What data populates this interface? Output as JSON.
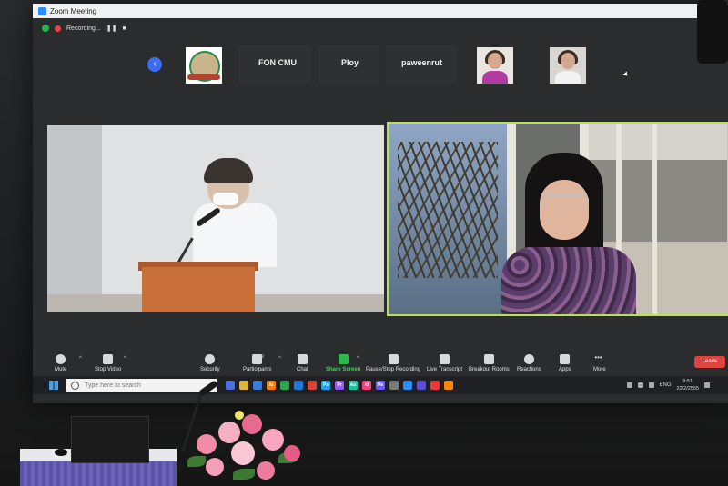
{
  "window": {
    "title": "Zoom Meeting",
    "controls": "– ◻ ✕"
  },
  "recording": {
    "label": "Recording..."
  },
  "participants_strip": {
    "names": [
      "FON CMU",
      "Ploy",
      "paweenrut"
    ]
  },
  "toolbar": {
    "mute": "Mute",
    "stop_video": "Stop Video",
    "security": "Security",
    "participants": "Participants",
    "participant_count": "9",
    "chat": "Chat",
    "share_screen": "Share Screen",
    "pause_stop_recording": "Pause/Stop Recording",
    "live_transcript": "Live Transcript",
    "breakout_rooms": "Breakout Rooms",
    "reactions": "Reactions",
    "apps": "Apps",
    "more": "More",
    "leave": "Leave"
  },
  "taskbar": {
    "search_placeholder": "Type here to search",
    "apps": [
      {
        "label": "",
        "color": "#4a6fe0"
      },
      {
        "label": "",
        "color": "#e0b33a"
      },
      {
        "label": "",
        "color": "#3a7bd5"
      },
      {
        "label": "Ai",
        "color": "#ff7c00"
      },
      {
        "label": "",
        "color": "#2aa84a"
      },
      {
        "label": "",
        "color": "#1f7ae0"
      },
      {
        "label": "",
        "color": "#d6453a"
      },
      {
        "label": "Ps",
        "color": "#1aa5ff"
      },
      {
        "label": "Pr",
        "color": "#9b59ff"
      },
      {
        "label": "Au",
        "color": "#18c3a0"
      },
      {
        "label": "Id",
        "color": "#ff3f7f"
      },
      {
        "label": "Me",
        "color": "#6b5bff"
      },
      {
        "label": "",
        "color": "#7a7a7a"
      },
      {
        "label": "",
        "color": "#2d8cff"
      },
      {
        "label": "",
        "color": "#5a4ed6"
      },
      {
        "label": "",
        "color": "#e83a3a"
      },
      {
        "label": "",
        "color": "#ff8800"
      }
    ],
    "lang": "ENG",
    "time": "9:51",
    "date": "22/2/2565"
  }
}
